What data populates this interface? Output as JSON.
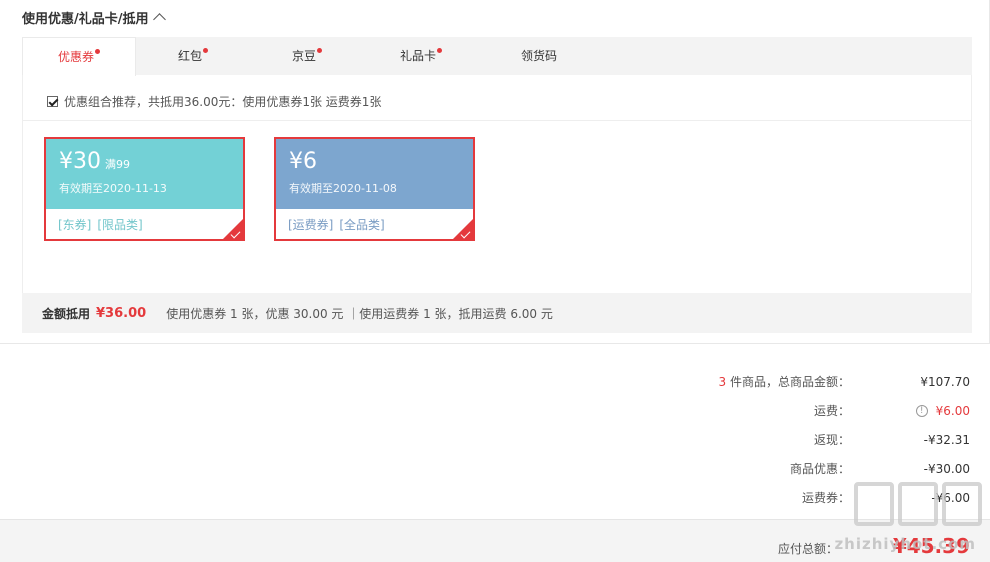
{
  "section": {
    "title": "使用优惠/礼品卡/抵用"
  },
  "tabs": [
    {
      "label": "优惠券",
      "dot": true
    },
    {
      "label": "红包",
      "dot": true
    },
    {
      "label": "京豆",
      "dot": true
    },
    {
      "label": "礼品卡",
      "dot": true
    },
    {
      "label": "领货码",
      "dot": false
    }
  ],
  "recommend": {
    "text": "优惠组合推荐，共抵用36.00元：使用优惠券1张 运费券1张",
    "checked": true
  },
  "coupons": [
    {
      "amount": "¥30",
      "condition": "满99",
      "expiry": "有效期至2020-11-13",
      "tags": [
        "[东券]",
        "[限品类]"
      ],
      "color": "#73d1d6"
    },
    {
      "amount": "¥6",
      "condition": "",
      "expiry": "有效期至2020-11-08",
      "tags": [
        "[运费券]",
        "[全品类]"
      ],
      "color": "#7da6cf"
    }
  ],
  "summary": {
    "label": "金额抵用",
    "amount": "¥36.00",
    "desc": "使用优惠券 1 张，优惠 30.00 元 ｜使用运费券 1 张，抵用运费 6.00 元"
  },
  "totals": {
    "count": "3",
    "goods_label": " 件商品，总商品金额：",
    "goods_value": "¥107.70",
    "shipping_label": "运费：",
    "shipping_value": "¥6.00",
    "cashback_label": "返现：",
    "cashback_value": "-¥32.31",
    "discount_label": "商品优惠：",
    "discount_value": "-¥30.00",
    "shipcoupon_label": "运费券：",
    "shipcoupon_value": "-¥6.00"
  },
  "footer": {
    "label": "应付总额：",
    "total": "¥45.39"
  },
  "watermark": {
    "text": "zhizhiyhot.com"
  },
  "colors": {
    "accent": "#e4393c",
    "coupon_teal": "#73d1d6",
    "coupon_blue": "#7da6cf"
  }
}
